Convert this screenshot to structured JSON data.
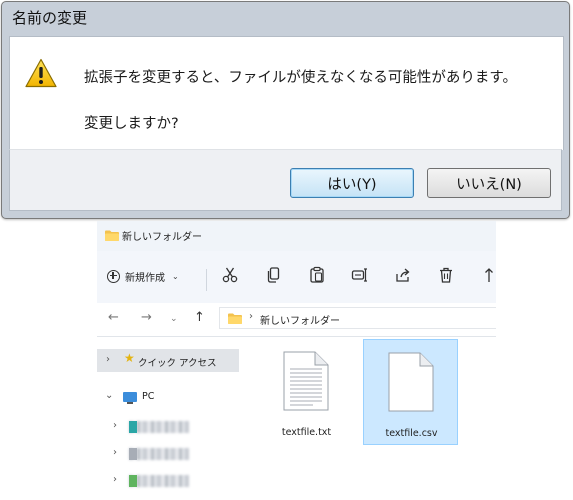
{
  "dialog": {
    "title": "名前の変更",
    "message_line1": "拡張子を変更すると、ファイルが使えなくなる可能性があります。",
    "message_line2": "変更しますか?",
    "yes_label": "はい(Y)",
    "no_label": "いいえ(N)",
    "icon": "warning-icon"
  },
  "explorer": {
    "window_title": "新しいフォルダー",
    "toolbar": {
      "new_label": "新規作成",
      "icons": [
        "cut-icon",
        "copy-icon",
        "paste-icon",
        "rename-icon",
        "share-icon",
        "delete-icon",
        "sort-icon"
      ]
    },
    "address": {
      "path": "新しいフォルダー"
    },
    "nav": {
      "quick_access": "クイック アクセス",
      "pc": "PC"
    },
    "files": [
      {
        "name": "textfile.txt",
        "selected": false
      },
      {
        "name": "textfile.csv",
        "selected": true
      }
    ]
  },
  "colors": {
    "dialog_frame": "#c7cfd9",
    "selection": "#cce8ff",
    "accent": "#3b8ddb"
  }
}
